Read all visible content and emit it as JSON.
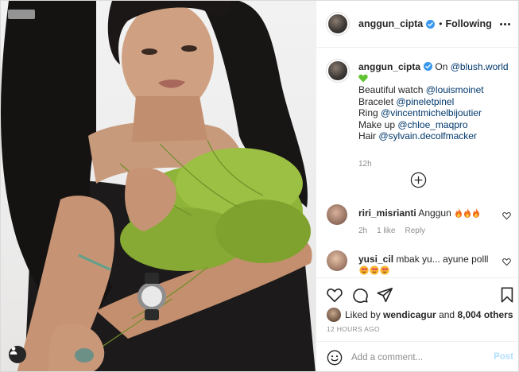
{
  "header": {
    "username": "anggun_cipta",
    "separator": "•",
    "follow_status": "Following"
  },
  "caption": {
    "username": "anggun_cipta",
    "lines": [
      "On",
      "@blush.world",
      "Beautiful watch",
      "@louismoinet",
      "Bracelet",
      "@pineletpinel",
      "Ring",
      "@vincentmichelbijoutier",
      "Make up",
      "@chloe_maqpro",
      "Hair",
      "@sylvain.decolfmacker"
    ],
    "time": "12h"
  },
  "comments": [
    {
      "username": "riri_misrianti",
      "text": "Anggun",
      "time": "2h",
      "likes": "1 like",
      "reply": "Reply"
    },
    {
      "username": "yusi_cil",
      "text": "mbak yu... ayune polll"
    }
  ],
  "likes": {
    "prefix": "Liked by",
    "user": "wendicagur",
    "mid": "and",
    "others": "8,004 others"
  },
  "timestamp": "12 HOURS AGO",
  "add_comment": {
    "placeholder": "Add a comment...",
    "post_label": "Post"
  },
  "icons": {
    "verified": "verified-badge-icon",
    "more": "more-options-icon",
    "load_more": "plus-circle-icon",
    "like": "heart-icon",
    "comment": "comment-bubble-icon",
    "share": "paper-plane-icon",
    "save": "bookmark-icon",
    "emoji": "smiley-icon",
    "user_tag": "user-tag-icon"
  },
  "colors": {
    "link": "#00376b",
    "verified": "#3897f0",
    "post_disabled": "#b2dffc",
    "meta": "#8e8e8e"
  }
}
